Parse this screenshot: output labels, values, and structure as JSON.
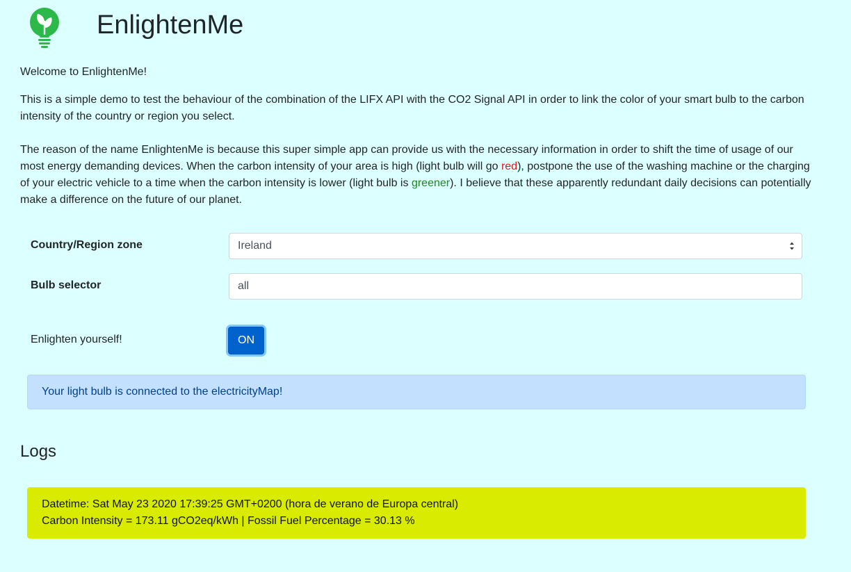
{
  "header": {
    "title": "EnlightenMe",
    "logo_icon": "lightbulb-leaf-icon",
    "logo_color": "#2db84a"
  },
  "intro": {
    "welcome": "Welcome to EnlightenMe!",
    "description": "This is a simple demo to test the behaviour of the combination of the LIFX API with the CO2 Signal API in order to link the color of your smart bulb to the carbon intensity of the country or region you select.",
    "reason_part1": "The reason of the name EnlightenMe is because this super simple app can provide us with the necessary information in order to shift the time of usage of our most energy demanding devices. When the carbon intensity of your area is high (light bulb will go ",
    "reason_red": "red",
    "reason_part2": "), postpone the use of the washing machine or the charging of your electric vehicle to a time when the carbon intensity is lower (light bulb is ",
    "reason_green": "greener",
    "reason_part3": "). I believe that these apparently redundant daily decisions can potentially make a difference on the future of our planet."
  },
  "form": {
    "zone_label": "Country/Region zone",
    "zone_value": "Ireland",
    "bulb_label": "Bulb selector",
    "bulb_value": "all",
    "toggle_label": "Enlighten yourself!",
    "toggle_button": "ON"
  },
  "status": {
    "message": "Your light bulb is connected to the electricityMap!"
  },
  "logs": {
    "title": "Logs",
    "entries": [
      {
        "datetime": "Datetime: Sat May 23 2020 17:39:25 GMT+0200 (hora de verano de Europa central)",
        "metrics": "Carbon Intensity = 173.11 gCO2eq/kWh | Fossil Fuel Percentage = 30.13 %",
        "color": "#d9ec00"
      }
    ]
  },
  "colors": {
    "background": "#dcffff",
    "accent": "#0062cc",
    "alert_info_bg": "#c4e0ff",
    "red_text": "#e8141b",
    "green_text": "#1a8a1a"
  }
}
